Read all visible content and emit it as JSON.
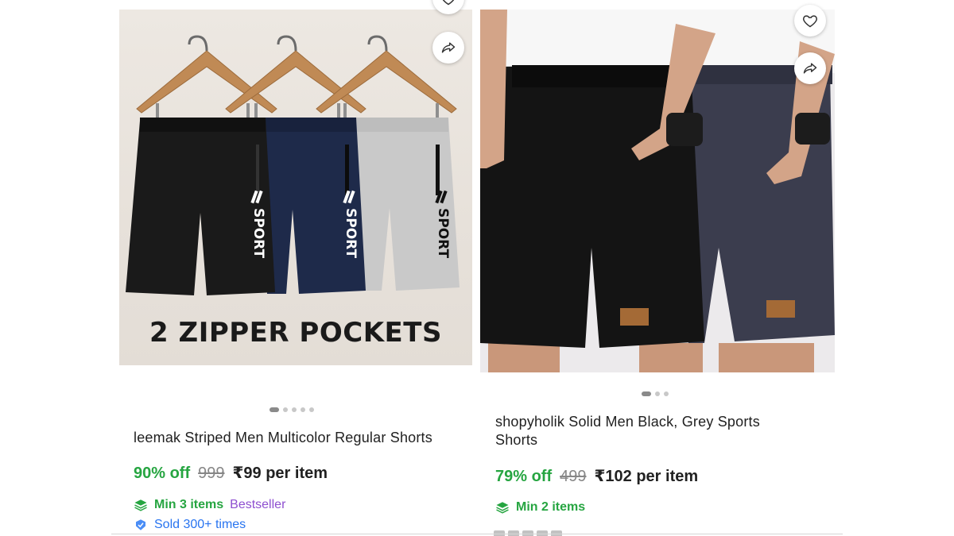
{
  "products": [
    {
      "title": "leemak Striped Men Multicolor Regular Shorts",
      "image_banner": "2 ZIPPER POCKETS",
      "print_text": "SPORT",
      "discount": "90% off",
      "mrp": "999",
      "price": "₹99 per item",
      "min_items": "Min 3 items",
      "badge": "Bestseller",
      "sold": "Sold 300+ times",
      "carousel": {
        "total": 5,
        "active": 0
      }
    },
    {
      "title_line1": "shopyholik Solid Men Black, Grey Sports",
      "title_line2": "Shorts",
      "discount": "79% off",
      "mrp": "499",
      "price": "₹102 per item",
      "min_items": "Min 2 items",
      "carousel": {
        "total": 3,
        "active": 0
      }
    }
  ],
  "icons": {
    "wishlist": "heart-icon",
    "share": "share-icon",
    "min_items": "stack-icon",
    "sold": "sold-badge-icon"
  },
  "colors": {
    "discount_green": "#26a541",
    "bestseller_purple": "#8e4fd0",
    "sold_blue": "#2874f0",
    "mrp_grey": "#878787"
  }
}
